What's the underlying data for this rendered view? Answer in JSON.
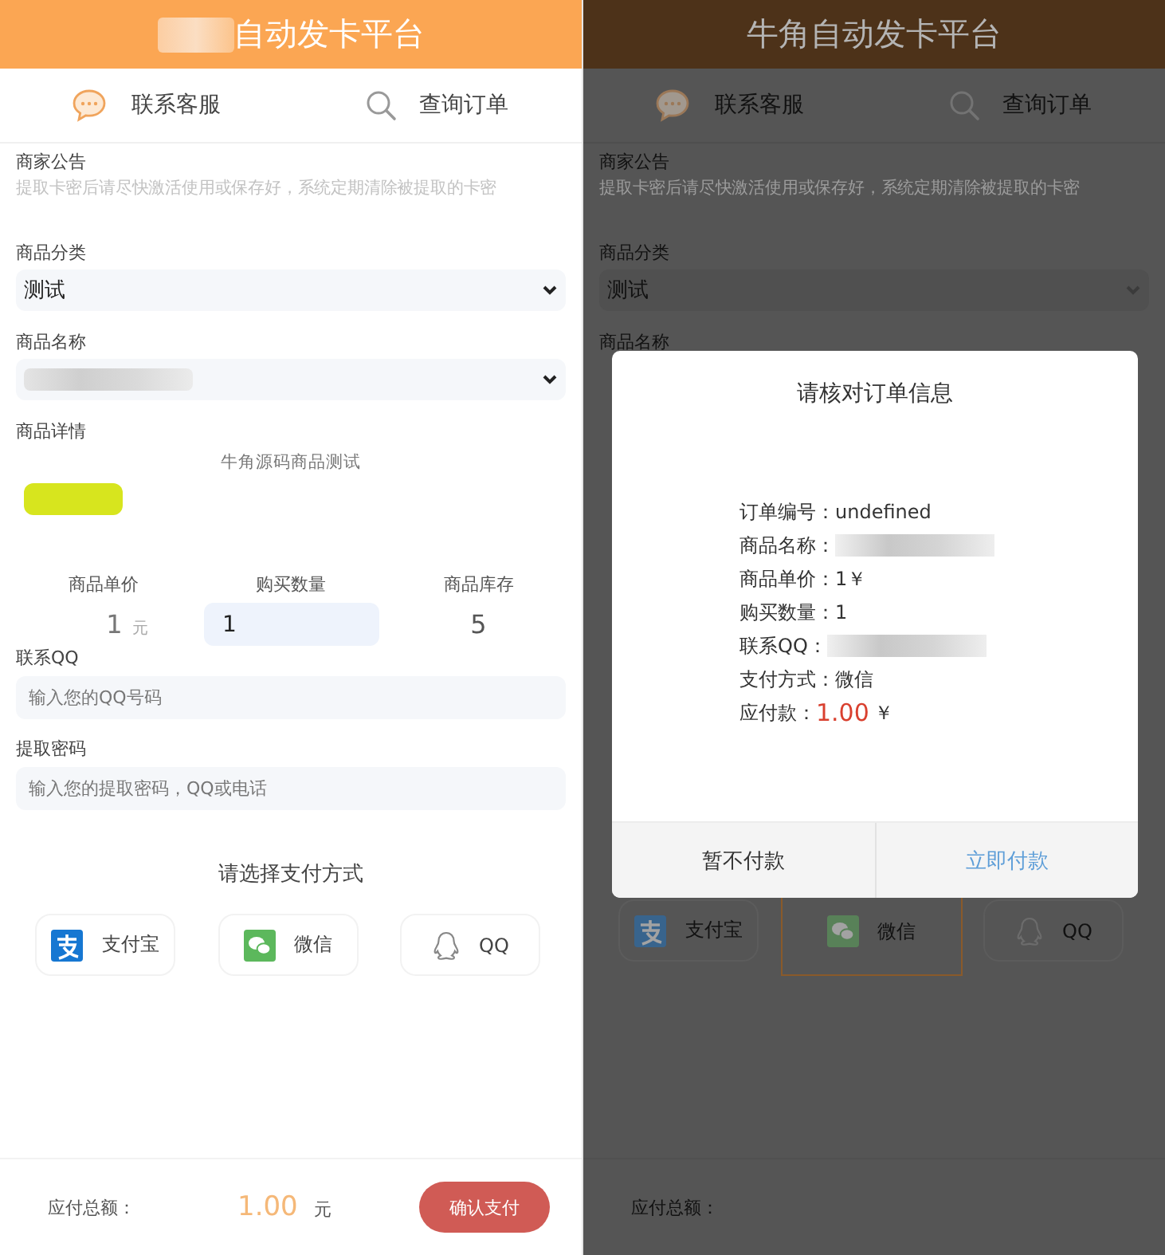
{
  "screens": [
    {
      "header": {
        "title": "自动发卡平台",
        "blurred_prefix": true
      },
      "nav": [
        {
          "label": "联系客服"
        },
        {
          "label": "查询订单"
        }
      ],
      "notice": {
        "label": "商家公告",
        "text": "提取卡密后请尽快激活使用或保存好，系统定期清除被提取的卡密"
      },
      "category": {
        "label": "商品分类",
        "value": "测试"
      },
      "product": {
        "label": "商品名称",
        "value_blurred": true
      },
      "details": {
        "label": "商品详情",
        "text": "牛角源码商品测试"
      },
      "stats": {
        "price_label": "商品单价",
        "price": "1",
        "price_unit": "元",
        "quantity_label": "购买数量",
        "quantity": "1",
        "stock_label": "商品库存",
        "stock": "5"
      },
      "qq": {
        "label": "联系QQ",
        "placeholder": "输入您的QQ号码"
      },
      "password": {
        "label": "提取密码",
        "placeholder": "输入您的提取密码，QQ或电话"
      },
      "payment": {
        "title": "请选择支付方式",
        "options": [
          {
            "label": "支付宝",
            "selected": false
          },
          {
            "label": "微信",
            "selected": false
          },
          {
            "label": "QQ",
            "selected": false
          }
        ]
      },
      "footer": {
        "label": "应付总额：",
        "amount": "1.00",
        "unit": "元",
        "button": "确认支付"
      }
    },
    {
      "header": {
        "title": "牛角自动发卡平台"
      },
      "nav": [
        {
          "label": "联系客服"
        },
        {
          "label": "查询订单"
        }
      ],
      "notice": {
        "label": "商家公告",
        "text": "提取卡密后请尽快激活使用或保存好，系统定期清除被提取的卡密"
      },
      "category": {
        "label": "商品分类",
        "value": "测试"
      },
      "product": {
        "label": "商品名称"
      },
      "payment": {
        "options": [
          {
            "label": "支付宝",
            "selected": false
          },
          {
            "label": "微信",
            "selected": true
          },
          {
            "label": "QQ",
            "selected": false
          }
        ]
      },
      "footer": {
        "label": "应付总额："
      },
      "modal": {
        "title": "请核对订单信息",
        "lines": [
          {
            "kind": "text",
            "label": "订单编号：",
            "value": "undefined"
          },
          {
            "kind": "blurred",
            "label": "商品名称："
          },
          {
            "kind": "text",
            "label": "商品单价：",
            "value": "1￥"
          },
          {
            "kind": "text",
            "label": "购买数量：",
            "value": "1"
          },
          {
            "kind": "blurred",
            "label": "联系QQ："
          },
          {
            "kind": "text",
            "label": "支付方式：",
            "value": "微信"
          },
          {
            "kind": "amount",
            "label": "应付款：",
            "value": "1.00",
            "suffix": "￥"
          }
        ],
        "buttons": [
          {
            "kind": "cancel",
            "label": "暂不付款"
          },
          {
            "kind": "confirm",
            "label": "立即付款"
          }
        ]
      }
    }
  ]
}
